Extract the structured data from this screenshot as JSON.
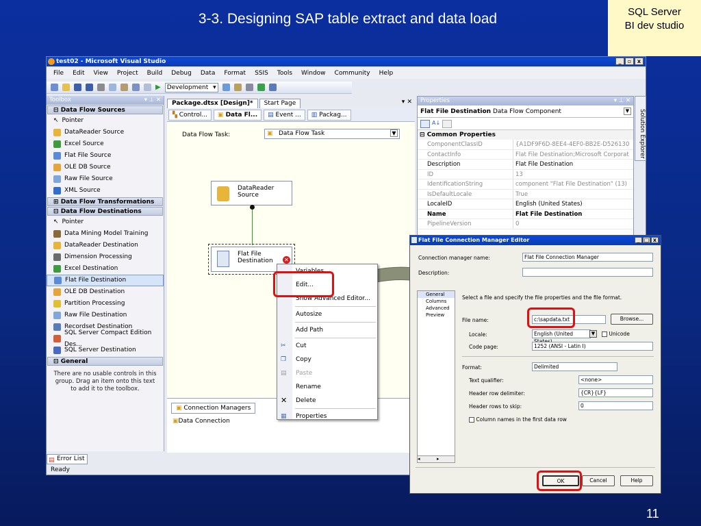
{
  "slide": {
    "title": "3-3. Designing SAP table extract and data load",
    "tag_line1": "SQL Server",
    "tag_line2": "BI dev studio",
    "page_number": "11"
  },
  "window": {
    "title": "test02 - Microsoft Visual Studio",
    "buttons": [
      "_",
      "4",
      "X"
    ]
  },
  "menu": [
    "File",
    "Edit",
    "View",
    "Project",
    "Build",
    "Debug",
    "Data",
    "Format",
    "SSIS",
    "Tools",
    "Window",
    "Community",
    "Help"
  ],
  "toolbar": {
    "config": "Development"
  },
  "toolbox": {
    "title": "Toolbox",
    "pin": "V p X",
    "categories": [
      {
        "label": "Data Flow Sources",
        "items": [
          "Pointer",
          "DataReader Source",
          "Excel Source",
          "Flat File Source",
          "OLE DB Source",
          "Raw File Source",
          "XML Source"
        ]
      },
      {
        "label": "Data Flow Transformations",
        "items": []
      },
      {
        "label": "Data Flow Destinations",
        "items": [
          "Pointer",
          "Data Mining Model Training",
          "DataReader Destination",
          "Dimension Processing",
          "Excel Destination",
          "Flat File Destination",
          "OLE DB Destination",
          "Partition Processing",
          "Raw File Destination",
          "Recordset Destination",
          "SQL Server Compact Edition Des...",
          "SQL Server Destination"
        ]
      },
      {
        "label": "General",
        "items": []
      }
    ],
    "note": "There are no usable controls in this group. Drag an item onto this text to add it to the toolbox."
  },
  "designer": {
    "tabs": [
      "Package.dtsx [Design]*",
      "Start Page"
    ],
    "close": "▾ X",
    "subtabs": [
      "Control...",
      "Data Fl...",
      "Event ...",
      "Packag..."
    ],
    "task_label": "Data Flow Task:",
    "task_value": "Data Flow Task",
    "source_name": "DataReader Source",
    "dest_name": "Flat File Destination",
    "conn_tab": "Connection Managers",
    "conn_item": "Data Connection"
  },
  "context_menu": [
    "Variables",
    "Edit...",
    "Show Advanced Editor...",
    "Autosize",
    "Add Path",
    "Cut",
    "Copy",
    "Paste",
    "Rename",
    "Delete",
    "Properties"
  ],
  "properties": {
    "title": "Properties",
    "object": "Flat File Destination",
    "object_type": "Data Flow Component",
    "section": "Common Properties",
    "rows": [
      {
        "k": "ComponentClassID",
        "v": "{A1DF9F6D-8EE4-4EF0-BB2E-D526130",
        "gray": true
      },
      {
        "k": "ContactInfo",
        "v": "Flat File Destination;Microsoft Corporat",
        "gray": true
      },
      {
        "k": "Description",
        "v": "Flat File Destination",
        "gray": false
      },
      {
        "k": "ID",
        "v": "13",
        "gray": true
      },
      {
        "k": "IdentificationString",
        "v": "component \"Flat File Destination\" (13)",
        "gray": true
      },
      {
        "k": "IsDefaultLocale",
        "v": "True",
        "gray": true
      },
      {
        "k": "LocaleID",
        "v": "English (United States)",
        "gray": false
      },
      {
        "k": "Name",
        "v": "Flat File Destination",
        "gray": false
      },
      {
        "k": "PipelineVersion",
        "v": "0",
        "gray": true
      }
    ],
    "solution_explorer": "Solution Explorer"
  },
  "dialog": {
    "title": "Flat File Connection Manager Editor",
    "conn_label": "Connection manager name:",
    "conn_value": "Flat File Connection Manager",
    "desc_label": "Description:",
    "nav": [
      "General",
      "Columns",
      "Advanced",
      "Preview"
    ],
    "intro": "Select a file and specify the file properties and the file format.",
    "filename_label": "File name:",
    "filename_value": "c:\\sapdata.txt",
    "browse": "Browse...",
    "locale_label": "Locale:",
    "locale_value": "English (United States)",
    "unicode": "Unicode",
    "codepage_label": "Code page:",
    "codepage_value": "1252  (ANSI - Latin I)",
    "format_label": "Format:",
    "format_value": "Delimited",
    "textq_label": "Text qualifier:",
    "textq_value": "<none>",
    "hrd_label": "Header row delimiter:",
    "hrd_value": "{CR}{LF}",
    "hrs_label": "Header rows to skip:",
    "hrs_value": "0",
    "colnames": "Column names in the first data row",
    "ok": "OK",
    "cancel": "Cancel",
    "help": "Help"
  },
  "bottom": {
    "error_list": "Error List",
    "status": "Ready"
  },
  "colors": {
    "slide_bg": "#0a2880",
    "tag_bg": "#fff9c8",
    "highlight": "#e01010",
    "vs_title": "#0a4ad8"
  }
}
